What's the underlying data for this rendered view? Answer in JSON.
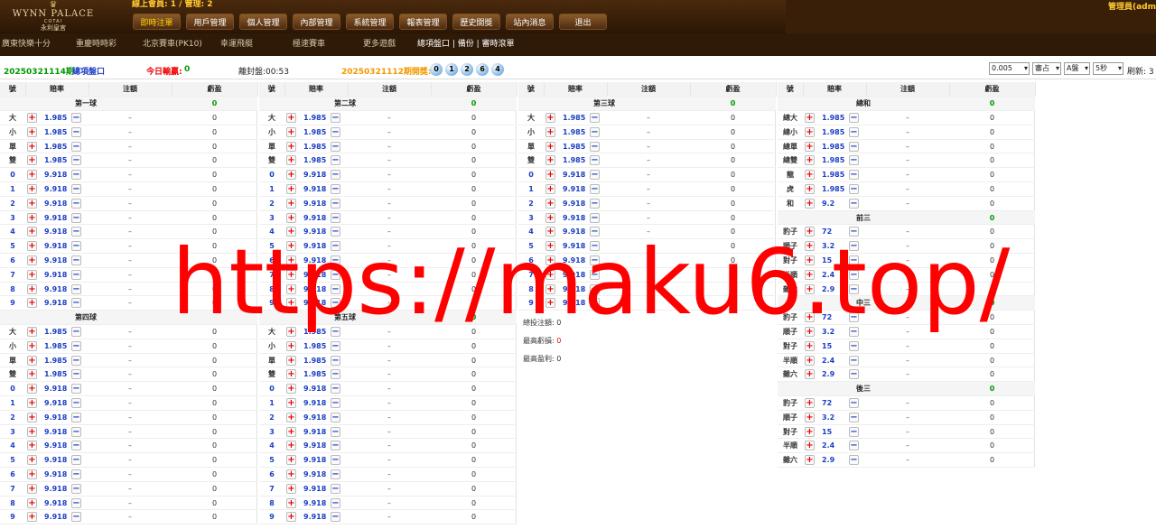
{
  "logo": {
    "crest": "♛",
    "main": "WYNN PALACE",
    "sub": "COTAI",
    "cn": "永利皇宮"
  },
  "header": {
    "online": "線上會員: 1 / 管理: 2",
    "admin": "管理員(adm",
    "menu": [
      "即時注單",
      "用戶管理",
      "個人管理",
      "內部管理",
      "系統管理",
      "報表管理",
      "歷史開獎",
      "站內消息",
      "退出"
    ]
  },
  "subnav": [
    "廣東快樂十分",
    "重慶時時彩",
    "北京賽車(PK10)",
    "幸運飛艇",
    "極速賽車",
    "更多遊戲",
    "總項盤口 | 備份 | 審時滾單"
  ],
  "info": {
    "period": "20250321114期",
    "panel_label": "總項盤口",
    "today_label": "今日輸贏:",
    "today_value": "0",
    "close_label": "離封盤:00:53",
    "last_period": "20250321112期開獎:",
    "balls": [
      "0",
      "1",
      "2",
      "6",
      "4"
    ],
    "selects": [
      "0.005",
      "審占",
      "A盤",
      "5秒"
    ],
    "refresh": "刷新: 3"
  },
  "headers": [
    "號",
    "賠率",
    "注額",
    "虧盈"
  ],
  "panels": [
    {
      "id": "p1",
      "sections": [
        {
          "title": "第一球",
          "value": "0",
          "rows": [
            {
              "l": "大",
              "o": "1.985",
              "a": "–",
              "p": "0"
            },
            {
              "l": "小",
              "o": "1.985",
              "a": "–",
              "p": "0"
            },
            {
              "l": "單",
              "o": "1.985",
              "a": "–",
              "p": "0"
            },
            {
              "l": "雙",
              "o": "1.985",
              "a": "–",
              "p": "0"
            },
            {
              "l": "0",
              "o": "9.918",
              "a": "–",
              "p": "0",
              "n": 1
            },
            {
              "l": "1",
              "o": "9.918",
              "a": "–",
              "p": "0",
              "n": 1
            },
            {
              "l": "2",
              "o": "9.918",
              "a": "–",
              "p": "0",
              "n": 1
            },
            {
              "l": "3",
              "o": "9.918",
              "a": "–",
              "p": "0",
              "n": 1
            },
            {
              "l": "4",
              "o": "9.918",
              "a": "–",
              "p": "0",
              "n": 1
            },
            {
              "l": "5",
              "o": "9.918",
              "a": "–",
              "p": "0",
              "n": 1
            },
            {
              "l": "6",
              "o": "9.918",
              "a": "–",
              "p": "0",
              "n": 1
            },
            {
              "l": "7",
              "o": "9.918",
              "a": "–",
              "p": "0",
              "n": 1
            },
            {
              "l": "8",
              "o": "9.918",
              "a": "–",
              "p": "0",
              "n": 1
            },
            {
              "l": "9",
              "o": "9.918",
              "a": "–",
              "p": "0",
              "n": 1
            }
          ]
        },
        {
          "title": "第四球",
          "value": "",
          "rows": [
            {
              "l": "大",
              "o": "1.985",
              "a": "–",
              "p": "0"
            },
            {
              "l": "小",
              "o": "1.985",
              "a": "–",
              "p": "0"
            },
            {
              "l": "單",
              "o": "1.985",
              "a": "–",
              "p": "0"
            },
            {
              "l": "雙",
              "o": "1.985",
              "a": "–",
              "p": "0"
            },
            {
              "l": "0",
              "o": "9.918",
              "a": "–",
              "p": "0",
              "n": 1
            },
            {
              "l": "1",
              "o": "9.918",
              "a": "–",
              "p": "0",
              "n": 1
            },
            {
              "l": "2",
              "o": "9.918",
              "a": "–",
              "p": "0",
              "n": 1
            },
            {
              "l": "3",
              "o": "9.918",
              "a": "–",
              "p": "0",
              "n": 1
            },
            {
              "l": "4",
              "o": "9.918",
              "a": "–",
              "p": "0",
              "n": 1
            },
            {
              "l": "5",
              "o": "9.918",
              "a": "–",
              "p": "0",
              "n": 1
            },
            {
              "l": "6",
              "o": "9.918",
              "a": "–",
              "p": "0",
              "n": 1
            },
            {
              "l": "7",
              "o": "9.918",
              "a": "–",
              "p": "0",
              "n": 1
            },
            {
              "l": "8",
              "o": "9.918",
              "a": "–",
              "p": "0",
              "n": 1
            },
            {
              "l": "9",
              "o": "9.918",
              "a": "–",
              "p": "0",
              "n": 1
            }
          ]
        }
      ]
    },
    {
      "id": "p2",
      "sections": [
        {
          "title": "第二球",
          "value": "0",
          "rows": [
            {
              "l": "大",
              "o": "1.985",
              "a": "–",
              "p": "0"
            },
            {
              "l": "小",
              "o": "1.985",
              "a": "–",
              "p": "0"
            },
            {
              "l": "單",
              "o": "1.985",
              "a": "–",
              "p": "0"
            },
            {
              "l": "雙",
              "o": "1.985",
              "a": "–",
              "p": "0"
            },
            {
              "l": "0",
              "o": "9.918",
              "a": "–",
              "p": "0",
              "n": 1
            },
            {
              "l": "1",
              "o": "9.918",
              "a": "–",
              "p": "0",
              "n": 1
            },
            {
              "l": "2",
              "o": "9.918",
              "a": "–",
              "p": "0",
              "n": 1
            },
            {
              "l": "3",
              "o": "9.918",
              "a": "–",
              "p": "0",
              "n": 1
            },
            {
              "l": "4",
              "o": "9.918",
              "a": "–",
              "p": "0",
              "n": 1
            },
            {
              "l": "5",
              "o": "9.918",
              "a": "–",
              "p": "0",
              "n": 1
            },
            {
              "l": "6",
              "o": "9.918",
              "a": "–",
              "p": "0",
              "n": 1
            },
            {
              "l": "7",
              "o": "9.918",
              "a": "–",
              "p": "0",
              "n": 1
            },
            {
              "l": "8",
              "o": "9.918",
              "a": "–",
              "p": "0",
              "n": 1
            },
            {
              "l": "9",
              "o": "9.918",
              "a": "–",
              "p": "0",
              "n": 1
            }
          ]
        },
        {
          "title": "第五球",
          "value": "0",
          "rows": [
            {
              "l": "大",
              "o": "1.985",
              "a": "–",
              "p": "0"
            },
            {
              "l": "小",
              "o": "1.985",
              "a": "–",
              "p": "0"
            },
            {
              "l": "單",
              "o": "1.985",
              "a": "–",
              "p": "0"
            },
            {
              "l": "雙",
              "o": "1.985",
              "a": "–",
              "p": "0"
            },
            {
              "l": "0",
              "o": "9.918",
              "a": "–",
              "p": "0",
              "n": 1
            },
            {
              "l": "1",
              "o": "9.918",
              "a": "–",
              "p": "0",
              "n": 1
            },
            {
              "l": "2",
              "o": "9.918",
              "a": "–",
              "p": "0",
              "n": 1
            },
            {
              "l": "3",
              "o": "9.918",
              "a": "–",
              "p": "0",
              "n": 1
            },
            {
              "l": "4",
              "o": "9.918",
              "a": "–",
              "p": "0",
              "n": 1
            },
            {
              "l": "5",
              "o": "9.918",
              "a": "–",
              "p": "0",
              "n": 1
            },
            {
              "l": "6",
              "o": "9.918",
              "a": "–",
              "p": "0",
              "n": 1
            },
            {
              "l": "7",
              "o": "9.918",
              "a": "–",
              "p": "0",
              "n": 1
            },
            {
              "l": "8",
              "o": "9.918",
              "a": "–",
              "p": "0",
              "n": 1
            },
            {
              "l": "9",
              "o": "9.918",
              "a": "–",
              "p": "0",
              "n": 1
            }
          ]
        }
      ]
    },
    {
      "id": "p3",
      "sections": [
        {
          "title": "第三球",
          "value": "0",
          "rows": [
            {
              "l": "大",
              "o": "1.985",
              "a": "–",
              "p": "0"
            },
            {
              "l": "小",
              "o": "1.985",
              "a": "–",
              "p": "0"
            },
            {
              "l": "單",
              "o": "1.985",
              "a": "–",
              "p": "0"
            },
            {
              "l": "雙",
              "o": "1.985",
              "a": "–",
              "p": "0"
            },
            {
              "l": "0",
              "o": "9.918",
              "a": "–",
              "p": "0",
              "n": 1
            },
            {
              "l": "1",
              "o": "9.918",
              "a": "–",
              "p": "0",
              "n": 1
            },
            {
              "l": "2",
              "o": "9.918",
              "a": "–",
              "p": "0",
              "n": 1
            },
            {
              "l": "3",
              "o": "9.918",
              "a": "–",
              "p": "0",
              "n": 1
            },
            {
              "l": "4",
              "o": "9.918",
              "a": "–",
              "p": "0",
              "n": 1
            },
            {
              "l": "5",
              "o": "9.918",
              "a": "–",
              "p": "0",
              "n": 1
            },
            {
              "l": "6",
              "o": "9.918",
              "a": "–",
              "p": "0",
              "n": 1
            },
            {
              "l": "7",
              "o": "9.918",
              "a": "–",
              "p": "0",
              "n": 1
            },
            {
              "l": "8",
              "o": "9.918",
              "a": "–",
              "p": "0",
              "n": 1
            },
            {
              "l": "9",
              "o": "9.918",
              "a": "–",
              "p": "0",
              "n": 1
            }
          ]
        }
      ]
    },
    {
      "id": "p4",
      "sections": [
        {
          "title": "總和",
          "value": "0",
          "rows": [
            {
              "l": "總大",
              "o": "1.985",
              "a": "–",
              "p": "0"
            },
            {
              "l": "總小",
              "o": "1.985",
              "a": "–",
              "p": "0"
            },
            {
              "l": "總單",
              "o": "1.985",
              "a": "–",
              "p": "0"
            },
            {
              "l": "總雙",
              "o": "1.985",
              "a": "–",
              "p": "0"
            },
            {
              "l": "龍",
              "o": "1.985",
              "a": "–",
              "p": "0"
            },
            {
              "l": "虎",
              "o": "1.985",
              "a": "–",
              "p": "0"
            },
            {
              "l": "和",
              "o": "9.2",
              "a": "–",
              "p": "0"
            }
          ]
        },
        {
          "title": "前三",
          "value": "0",
          "rows": [
            {
              "l": "豹子",
              "o": "72",
              "a": "–",
              "p": "0"
            },
            {
              "l": "順子",
              "o": "3.2",
              "a": "–",
              "p": "0"
            },
            {
              "l": "對子",
              "o": "15",
              "a": "–",
              "p": "0"
            },
            {
              "l": "半順",
              "o": "2.4",
              "a": "–",
              "p": "0"
            },
            {
              "l": "雜六",
              "o": "2.9",
              "a": "–",
              "p": "0"
            }
          ]
        },
        {
          "title": "中三",
          "value": "0",
          "rows": [
            {
              "l": "豹子",
              "o": "72",
              "a": "–",
              "p": "0"
            },
            {
              "l": "順子",
              "o": "3.2",
              "a": "–",
              "p": "0"
            },
            {
              "l": "對子",
              "o": "15",
              "a": "–",
              "p": "0"
            },
            {
              "l": "半順",
              "o": "2.4",
              "a": "–",
              "p": "0"
            },
            {
              "l": "雜六",
              "o": "2.9",
              "a": "–",
              "p": "0"
            }
          ]
        },
        {
          "title": "後三",
          "value": "0",
          "rows": [
            {
              "l": "豹子",
              "o": "72",
              "a": "–",
              "p": "0"
            },
            {
              "l": "順子",
              "o": "3.2",
              "a": "–",
              "p": "0"
            },
            {
              "l": "對子",
              "o": "15",
              "a": "–",
              "p": "0"
            },
            {
              "l": "半順",
              "o": "2.4",
              "a": "–",
              "p": "0"
            },
            {
              "l": "雜六",
              "o": "2.9",
              "a": "–",
              "p": "0"
            }
          ]
        }
      ]
    }
  ],
  "stats": [
    {
      "label": "總投注額:",
      "value": "0"
    },
    {
      "label": "最高虧損:",
      "value": "0",
      "red": 1
    },
    {
      "label": "最高盈利:",
      "value": "0"
    }
  ],
  "plus_glyph": "+",
  "minus_glyph": "−",
  "watermark": "https://maku6.top/"
}
